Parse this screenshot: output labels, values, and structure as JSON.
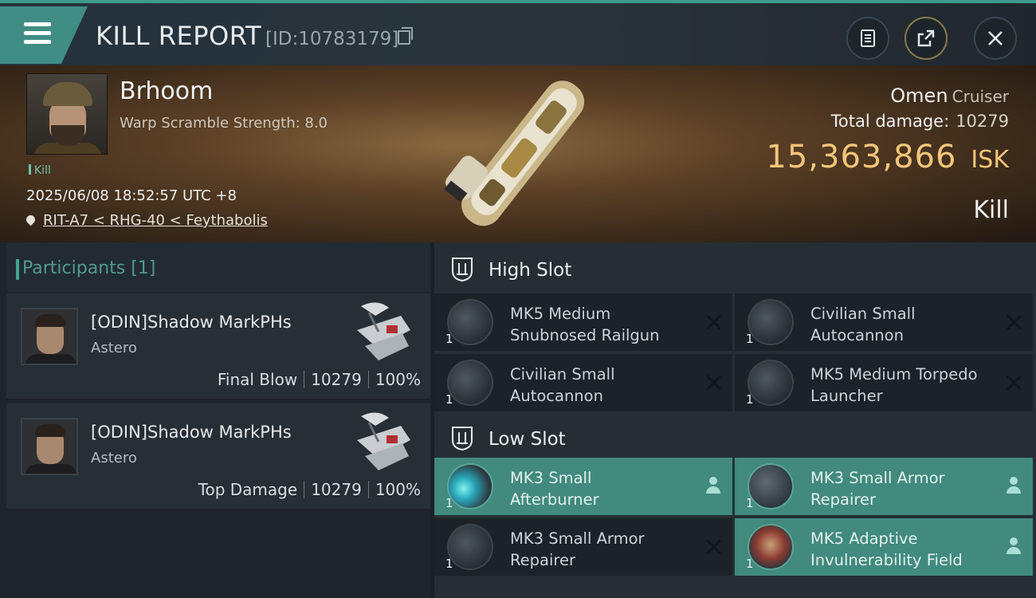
{
  "header": {
    "title": "KILL REPORT",
    "report_id": "[ID:10783179]",
    "menu_icon": "hamburger-icon",
    "actions": [
      "clipboard-icon",
      "share-icon",
      "close-icon"
    ]
  },
  "victim": {
    "name": "Brhoom",
    "warp_scramble": "Warp Scramble Strength: 8.0",
    "tag": "Kill",
    "datetime": "2025/06/08 18:52:57 UTC +8",
    "location": "RIT-A7 < RHG-40 < Feythabolis",
    "ship_name": "Omen",
    "ship_class": "Cruiser",
    "total_damage_label": "Total damage:",
    "total_damage_value": "10279",
    "isk_value": "15,363,866",
    "isk_unit": "ISK",
    "result": "Kill"
  },
  "participants": {
    "title": "Participants [1]",
    "rows": [
      {
        "name": "[ODIN]Shadow MarkPHs",
        "ship": "Astero",
        "role": "Final Blow",
        "damage": "10279",
        "percent": "100%"
      },
      {
        "name": "[ODIN]Shadow MarkPHs",
        "ship": "Astero",
        "role": "Top Damage",
        "damage": "10279",
        "percent": "100%"
      }
    ]
  },
  "fitting": {
    "high_slot_label": "High Slot",
    "low_slot_label": "Low Slot",
    "high_slot": [
      {
        "line1": "MK5 Medium",
        "line2": "Snubnosed Railgun",
        "qty": "1",
        "status": "destroyed"
      },
      {
        "line1": "Civilian Small",
        "line2": "Autocannon",
        "qty": "1",
        "status": "destroyed"
      },
      {
        "line1": "Civilian Small",
        "line2": "Autocannon",
        "qty": "1",
        "status": "destroyed"
      },
      {
        "line1": "MK5 Medium Torpedo",
        "line2": "Launcher",
        "qty": "1",
        "status": "destroyed"
      }
    ],
    "low_slot": [
      {
        "line1": "MK3 Small",
        "line2": "Afterburner",
        "qty": "1",
        "status": "dropped"
      },
      {
        "line1": "MK3 Small Armor",
        "line2": "Repairer",
        "qty": "1",
        "status": "dropped"
      },
      {
        "line1": "MK3 Small Armor",
        "line2": "Repairer",
        "qty": "1",
        "status": "destroyed"
      },
      {
        "line1": "MK5 Adaptive",
        "line2": "Invulnerability Field",
        "qty": "1",
        "status": "dropped"
      }
    ]
  },
  "colors": {
    "accent": "#3fa491",
    "fitted_bg": "#418a7d",
    "isk": "#f4c67a"
  }
}
